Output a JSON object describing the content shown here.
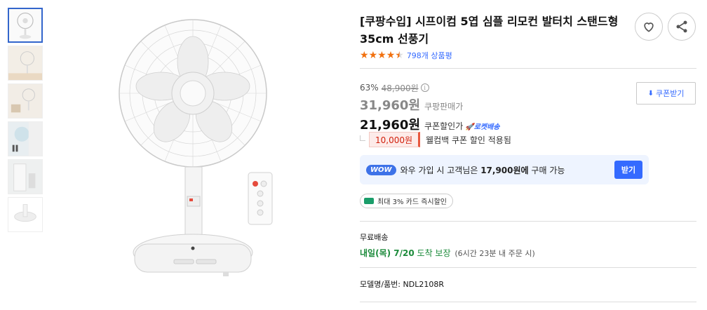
{
  "product": {
    "title": "[쿠팡수입] 시프이컴 5엽 심플 리모컨 발터치 스탠드형 35cm 선풍기",
    "rating": 4.5,
    "review_count": "798개 상품평"
  },
  "price": {
    "discount_rate": "63%",
    "original_price": "48,900원",
    "sale_price": "31,960원",
    "sale_label": "쿠팡판매가",
    "coupon_price": "21,960원",
    "coupon_label": "쿠폰할인가",
    "rocket_label": "로켓배송",
    "coupon_button": "쿠폰받기"
  },
  "welcome": {
    "amount": "10,000원",
    "text": "웰컴백 쿠폰 할인 적용됨"
  },
  "wow": {
    "badge": "WOW",
    "text_prefix": "와우 가입 시 고객님은",
    "text_amount": "17,900원에",
    "text_suffix": "구매 가능",
    "button": "받기"
  },
  "card": {
    "text": "최대 3% 카드 즉시할인"
  },
  "shipping": {
    "label": "무료배송",
    "date": "내일(목) 7/20",
    "guarantee": "도착 보장",
    "note": "(6시간 23분 내 주문 시)"
  },
  "model": {
    "text": "모델명/품번: NDL2108R"
  },
  "icons": {
    "heart": "heart-icon",
    "share": "share-icon",
    "download": "download-icon",
    "info": "info-icon"
  },
  "colors": {
    "accent": "#346aff",
    "star": "#f1700e",
    "shipping_green": "#1c8b3b",
    "coupon_red": "#d11f0b"
  }
}
